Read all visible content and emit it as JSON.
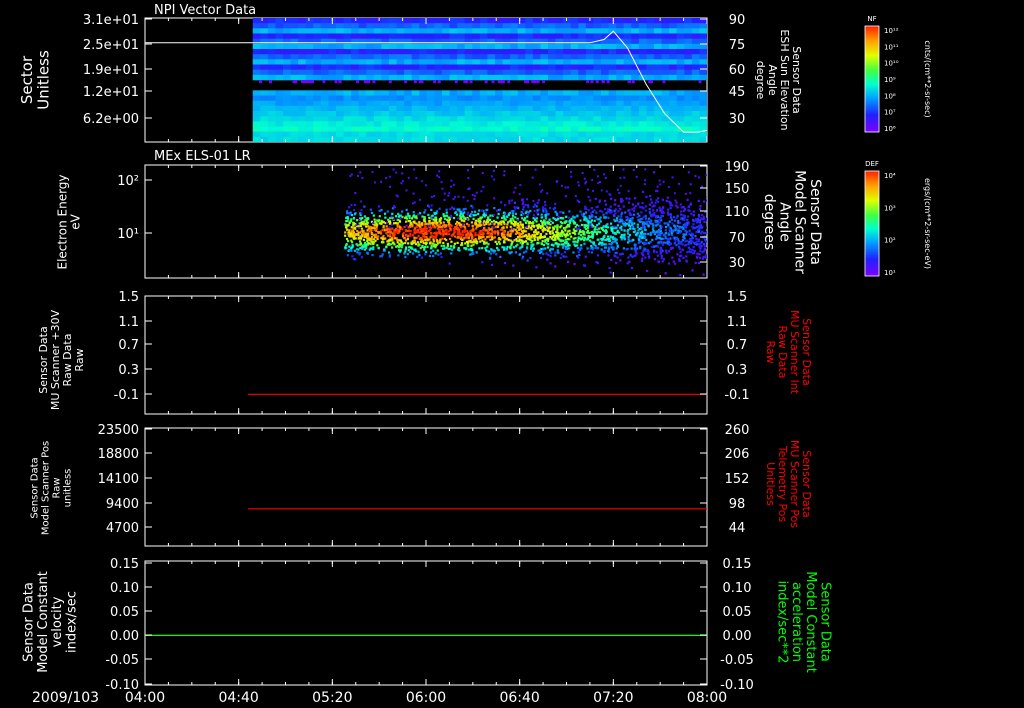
{
  "date_label": "2009/103",
  "time_ticks": [
    "04:00",
    "04:40",
    "05:20",
    "06:00",
    "06:40",
    "07:20",
    "08:00"
  ],
  "colors": {
    "background": "#000000",
    "foreground": "#ffffff",
    "red_trace": "#ff0000",
    "green_trace": "#00ff00"
  },
  "colorbars": [
    {
      "badge": "NF",
      "ticks": [
        "10¹²",
        "10¹¹",
        "10¹⁰",
        "10⁹",
        "10⁸",
        "10⁷",
        "10⁶"
      ],
      "units": "cnts/(cm**2-sr-sec)"
    },
    {
      "badge": "DEF",
      "ticks": [
        "10⁴",
        "10³",
        "10²",
        "10¹"
      ],
      "units": "ergs/(cm**2-sr-sec-eV)"
    }
  ],
  "chart_data": [
    {
      "type": "heatmap",
      "title": "NPI Vector Data",
      "ylabel": [
        "Sector",
        "Unitless"
      ],
      "y_ticks": [
        "3.1e+01",
        "2.5e+01",
        "1.9e+01",
        "1.2e+01",
        "6.2e+00"
      ],
      "right_label": [
        "Sensor Data",
        "ESH Sun Elevation",
        "Angle",
        "degree"
      ],
      "right_ticks": [
        "90",
        "75",
        "60",
        "45",
        "30"
      ],
      "right_range": [
        15,
        90
      ],
      "data_start": "04:46",
      "overlay": {
        "name": "ESH Sun Elevation Angle",
        "x": [
          "04:00",
          "07:10",
          "07:16",
          "07:20",
          "07:26",
          "07:34",
          "07:42",
          "07:50",
          "07:56",
          "08:00"
        ],
        "y": [
          75,
          75,
          77,
          82,
          72,
          50,
          32,
          21,
          21,
          22
        ]
      }
    },
    {
      "type": "heatmap",
      "title": "MEx ELS-01 LR",
      "ylabel": [
        "Electron Energy",
        "eV"
      ],
      "y_ticks": [
        "10²",
        "10¹"
      ],
      "right_label": [
        "Sensor Data",
        "Model Scanner",
        "Angle",
        "degrees"
      ],
      "right_ticks": [
        "190",
        "150",
        "110",
        "70",
        "30"
      ],
      "right_range": [
        5,
        190
      ],
      "data_start": "05:25",
      "overlay": {
        "name": "Model Scanner Angle",
        "x": [
          "04:00",
          "08:00"
        ],
        "y": [
          5,
          5
        ]
      }
    },
    {
      "type": "line",
      "ylabel": [
        "Sensor Data",
        "MU Scanner +30V",
        "Raw Data",
        "Raw"
      ],
      "y_ticks": [
        "1.5",
        "1.1",
        "0.7",
        "0.3",
        "-0.1"
      ],
      "y_range": [
        -0.3,
        1.5
      ],
      "right_label": [
        "Sensor Data",
        "MU Scanner Int",
        "Raw Data",
        "Raw"
      ],
      "right_ticks": [
        "1.5",
        "1.1",
        "0.7",
        "0.3",
        "-0.1"
      ],
      "series": [
        {
          "color": "#ff0000",
          "x": [
            "04:44",
            "08:00"
          ],
          "y": [
            0.0,
            0.0
          ]
        }
      ]
    },
    {
      "type": "line",
      "ylabel": [
        "Sensor Data",
        "Model Scanner Pos",
        "Raw",
        "unitless"
      ],
      "y_ticks": [
        "23500",
        "18800",
        "14100",
        "9400",
        "4700"
      ],
      "y_range": [
        0,
        23500
      ],
      "right_label": [
        "Sensor Data",
        "MU Scanner Pos",
        "Telemetry Pos",
        "Unitless"
      ],
      "right_ticks": [
        "260",
        "206",
        "152",
        "98",
        "44"
      ],
      "series": [
        {
          "color": "#ff0000",
          "x": [
            "04:44",
            "08:00"
          ],
          "y": [
            7400,
            7400
          ]
        }
      ]
    },
    {
      "type": "line",
      "ylabel": [
        "Sensor Data",
        "Model Constant",
        "velocity",
        "index/sec"
      ],
      "y_ticks": [
        "0.15",
        "0.10",
        "0.05",
        "0.00",
        "-0.05",
        "-0.10"
      ],
      "y_range": [
        -0.1,
        0.15
      ],
      "right_label": [
        "Sensor Data",
        "Model Constant",
        "acceleration",
        "index/sec**2"
      ],
      "right_ticks": [
        "0.15",
        "0.10",
        "0.05",
        "0.00",
        "-0.05",
        "-0.10"
      ],
      "series": [
        {
          "color": "#00ff00",
          "x": [
            "04:00",
            "08:00"
          ],
          "y": [
            0.0,
            0.0
          ]
        }
      ]
    }
  ]
}
